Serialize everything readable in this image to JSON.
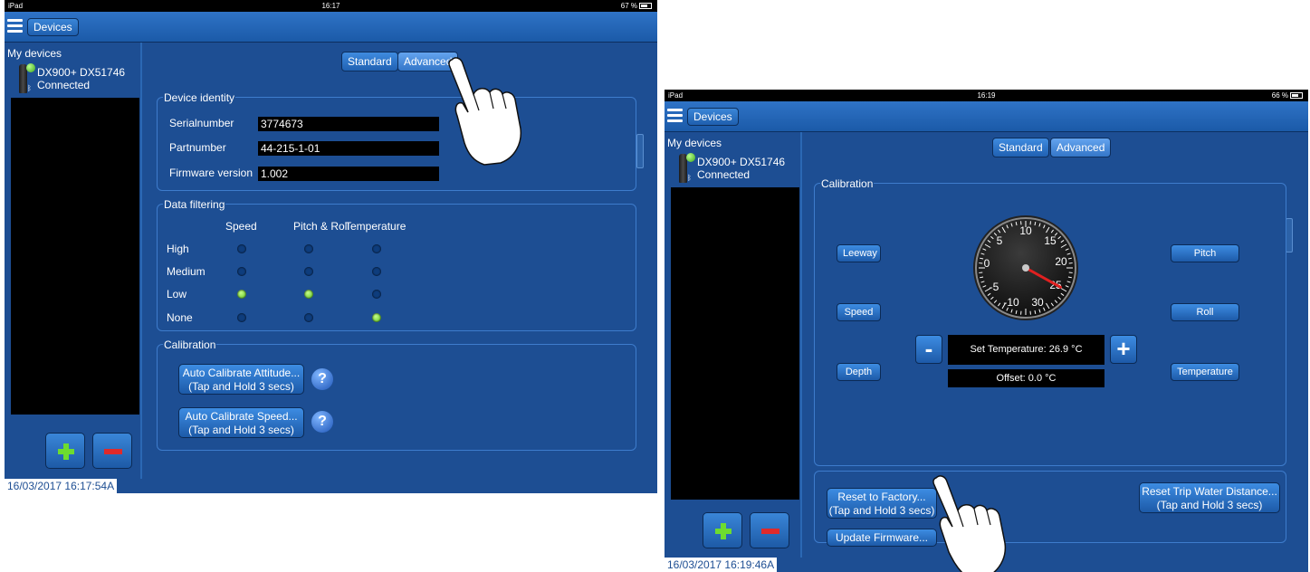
{
  "left": {
    "status": {
      "device": "iPad",
      "time": "16:17",
      "battery": "67 %"
    },
    "nav": {
      "devices_label": "Devices"
    },
    "sidebar": {
      "header": "My devices",
      "device_name": "DX900+ DX51746",
      "device_status": "Connected"
    },
    "tabs": {
      "standard": "Standard",
      "advanced": "Advanced"
    },
    "identity": {
      "title": "Device identity",
      "serial_label": "Serialnumber",
      "serial_value": "3774673",
      "part_label": "Partnumber",
      "part_value": "44-215-1-01",
      "firmware_label": "Firmware version",
      "firmware_value": "1.002"
    },
    "filtering": {
      "title": "Data filtering",
      "columns": [
        "Speed",
        "Pitch & Roll",
        "Temperature"
      ],
      "rows": [
        "High",
        "Medium",
        "Low",
        "None"
      ],
      "selected": {
        "speed": "Low",
        "pitch_roll": "Low",
        "temperature": "None"
      }
    },
    "calibration": {
      "title": "Calibration",
      "attitude_line1": "Auto Calibrate Attitude...",
      "attitude_line2": "(Tap and Hold 3 secs)",
      "speed_line1": "Auto Calibrate Speed...",
      "speed_line2": "(Tap and Hold 3 secs)",
      "help": "?"
    },
    "footer": "16/03/2017 16:17:54A"
  },
  "right": {
    "status": {
      "device": "iPad",
      "time": "16:19",
      "battery": "66 %"
    },
    "nav": {
      "devices_label": "Devices"
    },
    "sidebar": {
      "header": "My devices",
      "device_name": "DX900+ DX51746",
      "device_status": "Connected"
    },
    "tabs": {
      "standard": "Standard",
      "advanced": "Advanced"
    },
    "calibration": {
      "title": "Calibration",
      "leeway": "Leeway",
      "speed": "Speed",
      "depth": "Depth",
      "pitch": "Pitch",
      "roll": "Roll",
      "temperature": "Temperature",
      "set_temperature": "Set Temperature: 26.9 °C",
      "offset": "Offset: 0.0 °C",
      "minus": "-",
      "plus": "+",
      "gauge_ticks": [
        "10",
        "15",
        "20",
        "25",
        "30",
        "-10",
        "-5",
        "0",
        "5"
      ],
      "gauge_value": 26.9
    },
    "actions": {
      "reset_factory_line1": "Reset to Factory...",
      "reset_factory_line2": "(Tap and Hold 3 secs)",
      "update_firmware": "Update Firmware...",
      "reset_trip_line1": "Reset Trip Water Distance...",
      "reset_trip_line2": "(Tap and Hold 3 secs)"
    },
    "footer": "16/03/2017 16:19:46A"
  }
}
